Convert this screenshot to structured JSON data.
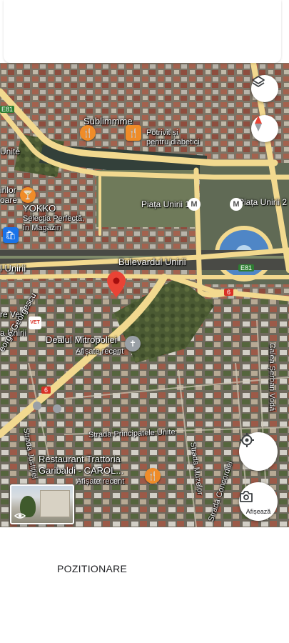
{
  "colors": {
    "road_major": "#f2d98f",
    "pin_red": "#ea4335",
    "poi_orange": "#f08c28",
    "poi_blue": "#1a73e8",
    "poi_grey": "#9aa0a6"
  },
  "map": {
    "streets": {
      "bulevardul_unirii_main": "Bulevardul Unirii",
      "bulevardul_unirii_left": "l Unirii",
      "strada_principatele_unite": "Strada Principatele Unite",
      "strada_justitiei": "Strada Justiției",
      "george_georgescu": "eorge Georgescu",
      "strada_muzelor": "Strada Muzelor",
      "strada_concordiei": "Strada Concordiei",
      "calea_serban_voda": "Calea Șerban Vodă",
      "road_e81_badge": "E81",
      "road_e81_left": "E81",
      "road_6_right": "6",
      "road_6_left": "6"
    },
    "places": {
      "sublimmme_title": "Sublimmme",
      "sublimmme_sub1": "Potrivit și",
      "sublimmme_sub2": "pentru diabetici",
      "unite_partial": "Unite",
      "irilor_partial": "irilor",
      "oare_partial": "oare",
      "yokko_title": "YOKKO",
      "yokko_sub1": "Selecția Perfectă,",
      "yokko_sub2": "în Magazin",
      "piata_unirii_1": "Piața Unirii 1",
      "piata_unirii_2": "Piața Unirii 2",
      "vet_partial_1": "re Vet",
      "vet_partial_2": "a Unirii",
      "vet_icon_text": "VET",
      "dealul_title": "Dealul Mitropoliei",
      "dealul_sub": "Afișate recent",
      "restaurant_title1": "Restaurant Trattoria",
      "restaurant_title2": "Garibaldi - CAROL...",
      "restaurant_sub": "Afișate recent",
      "metro_symbol": "M"
    },
    "controls": {
      "layers_icon": "layers-icon",
      "compass_icon": "compass-icon",
      "my_location_icon": "my-location-icon",
      "display_label": "Afișează"
    }
  },
  "caption": "POZITIONARE"
}
